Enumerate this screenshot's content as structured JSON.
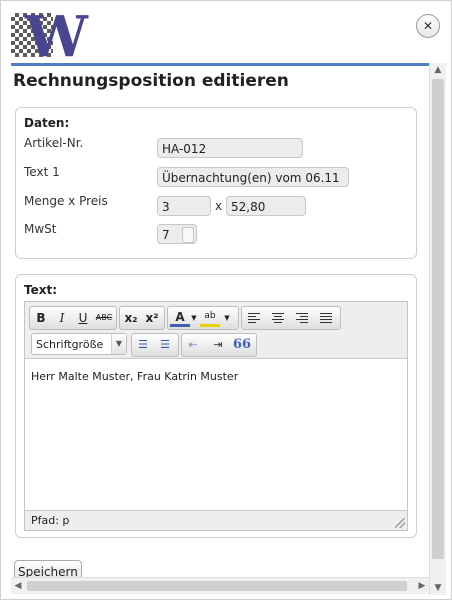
{
  "logo": {
    "letter": "W"
  },
  "dialog": {
    "title": "Rechnungsposition editieren",
    "close_icon": "close-icon"
  },
  "data_section": {
    "legend": "Daten:",
    "fields": {
      "artikel_label": "Artikel-Nr.",
      "artikel_value": "HA-012",
      "text1_label": "Text 1",
      "text1_value": "Übernachtung(en) vom 06.11",
      "menge_label": "Menge x Preis",
      "menge_value": "3",
      "times": "x",
      "preis_value": "52,80",
      "mwst_label": "MwSt",
      "mwst_value": "7"
    }
  },
  "text_section": {
    "legend": "Text:",
    "toolbar": {
      "bold": "B",
      "italic": "I",
      "underline": "U",
      "strike": "ABC",
      "subscript": "x₂",
      "superscript": "x²",
      "font_color": "A",
      "highlight": "ab",
      "font_size_select": "Schriftgröße",
      "blockquote": "66"
    },
    "content": "Herr Malte Muster, Frau Katrin Muster",
    "status_path": "Pfad: p"
  },
  "footer": {
    "save_label": "Speichern"
  },
  "colors": {
    "accent_blue": "#4f7fc2",
    "logo_purple": "#4a4590"
  }
}
